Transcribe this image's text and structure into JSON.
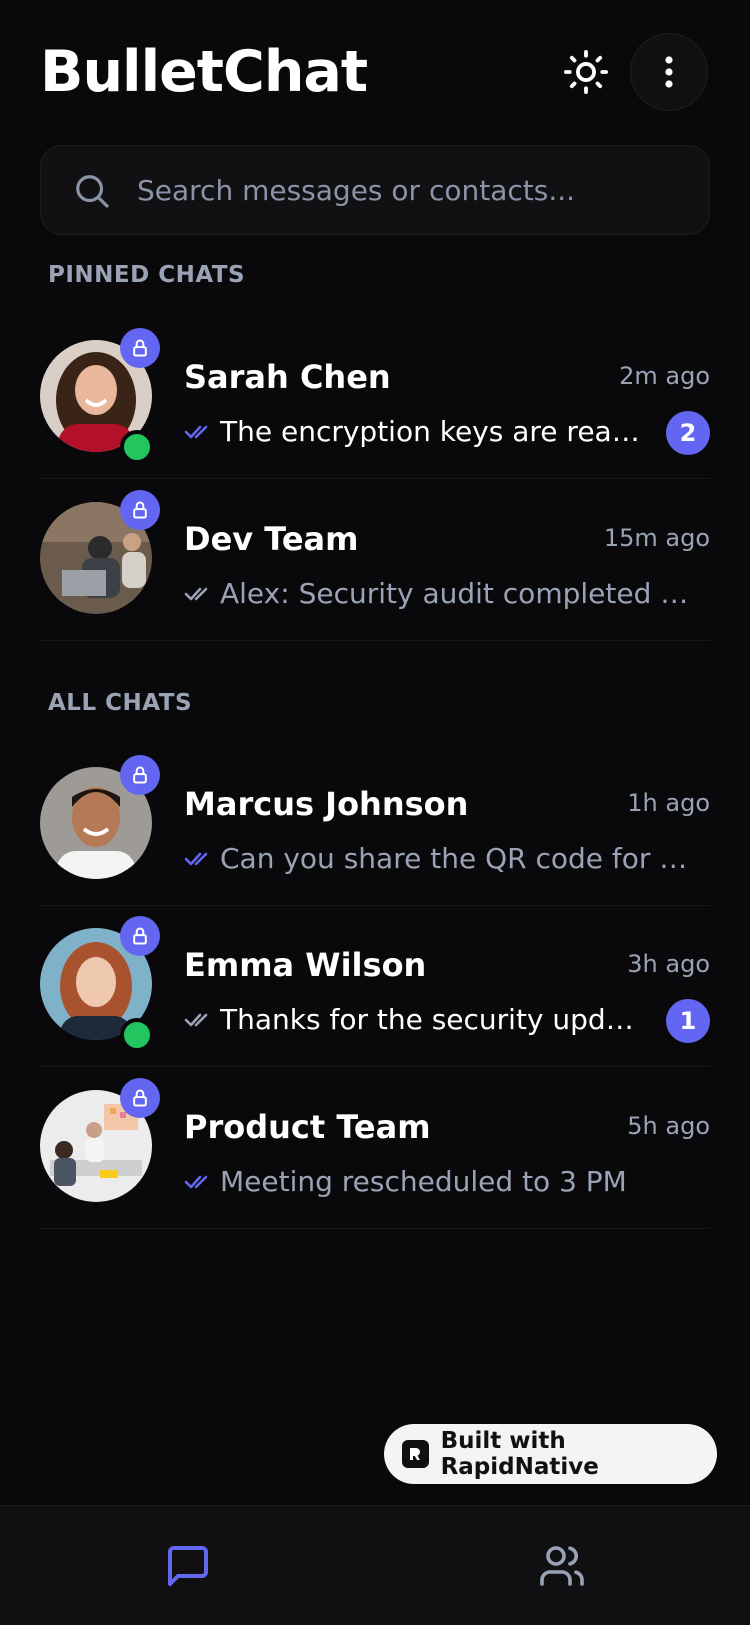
{
  "app": {
    "title": "BulletChat"
  },
  "search": {
    "placeholder": "Search messages or contacts..."
  },
  "sections": {
    "pinned": "PINNED CHATS",
    "all": "ALL CHATS"
  },
  "chats": [
    {
      "name": "Sarah Chen",
      "time": "2m ago",
      "message": "The encryption keys are ready for the new project",
      "unread": "2",
      "online": true,
      "read": true
    },
    {
      "name": "Dev Team",
      "time": "15m ago",
      "message": "Alex: Security audit completed successfully",
      "unread": "",
      "online": false,
      "read": false
    },
    {
      "name": "Marcus Johnson",
      "time": "1h ago",
      "message": "Can you share the QR code for the verification?",
      "unread": "",
      "online": false,
      "read": true
    },
    {
      "name": "Emma Wilson",
      "time": "3h ago",
      "message": "Thanks for the security update!",
      "unread": "1",
      "online": true,
      "read": false
    },
    {
      "name": "Product Team",
      "time": "5h ago",
      "message": "Meeting rescheduled to 3 PM",
      "unread": "",
      "online": false,
      "read": true
    }
  ],
  "badge": {
    "label": "Built with RapidNative"
  },
  "colors": {
    "accent": "#6366f1",
    "online": "#22c55e",
    "background": "#09090b",
    "muted": "#9aa3b5"
  },
  "icons": {
    "theme": "sun-icon",
    "menu": "more-vertical-icon",
    "search": "search-icon",
    "lock": "lock-icon",
    "chats_tab": "message-square-icon",
    "contacts_tab": "users-icon"
  }
}
